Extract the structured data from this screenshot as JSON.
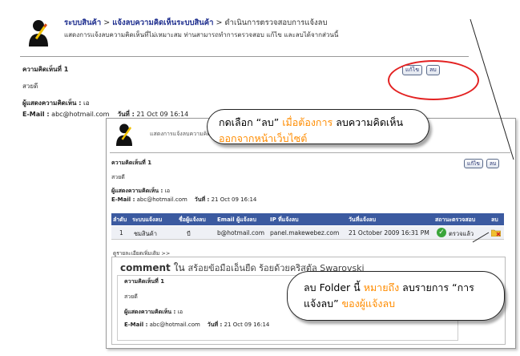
{
  "top": {
    "breadcrumb": {
      "item1": "ระบบสินค้า",
      "sep1": " > ",
      "item2": "แจ้งลบความคิดเห็นระบบสินค้า",
      "sep2": " > ",
      "item3": "ดำเนินการตรวจสอบการแจ้งลบ"
    },
    "subtitle": "แสดงการแจ้งลบความคิดเห็นที่ไม่เหมาะสม ท่านสามารถทำการตรวจสอบ แก้ไข และลบได้จากส่วนนี้",
    "comment_title": "ความคิดเห็นที่ 1",
    "comment_text": "สวยดี",
    "author_label": "ผู้แสดงความคิดเห็น :",
    "author_value": " เอ",
    "email_label": "E-Mail :",
    "email_value": " abc@hotmail.com",
    "date_label": "วันที่ :",
    "date_value": " 21 Oct 09 16:14",
    "edit_button": "แก้ไข",
    "delete_button": "ลบ"
  },
  "callout1": {
    "part1": "กดเลือก “ลบ” ",
    "part2": "เมื่อต้องการ",
    "part3": " ลบความคิดเห็น ",
    "part4": "ออกจากหน้าเว็บไซต์"
  },
  "second": {
    "subtitle": "แสดงการแจ้งลบความคิดเ",
    "comment_title": "ความคิดเห็นที่ 1",
    "comment_text": "สวยดี",
    "author_label": "ผู้แสดงความคิดเห็น :",
    "author_value": " เอ",
    "email_label": "E-Mail :",
    "email_value": " abc@hotmail.com",
    "date_label": "วันที่ :",
    "date_value": " 21 Oct 09 16:14",
    "edit_button": "แก้ไข",
    "delete_button": "ลบ",
    "table": {
      "headers": [
        "ลำดับ",
        "ระบบแจ้งลบ",
        "ชื่อผู้แจ้งลบ",
        "Email ผู้แจ้งลบ",
        "IP ที่แจ้งลบ",
        "วันที่แจ้งลบ",
        "สถานะตรวจสอบ",
        "ลบ"
      ],
      "row": {
        "no": "1",
        "system": "ชมสินค้า",
        "name": "บี",
        "email": "b@hotmail.com",
        "ip": "panel.makewebez.com",
        "date": "21 October 2009 16:31 PM",
        "status": "ตรวจแล้ว"
      }
    },
    "details_link": "ดูรายละเอียดเพิ่มเติม >>",
    "detail": {
      "comment_word": "comment",
      "in_word": " ใน ",
      "product": "สร้อยข้อมือเอ็นยืด ร้อยด้วยคริสตัล Swarovski",
      "comment_title": "ความคิดเห็นที่ 1",
      "comment_text": "สวยดี",
      "author_label": "ผู้แสดงความคิดเห็น :",
      "author_value": " เอ",
      "email_label": "E-Mail :",
      "email_value": " abc@hotmail.com",
      "date_label": "วันที่ :",
      "date_value": " 21 Oct 09 16:14"
    }
  },
  "callout2": {
    "part1": "ลบ Folder นี้ ",
    "part2": "หมายถึง",
    "part3": " ลบรายการ “การแจ้งลบ” ",
    "part4": "ของผู้แจ้งลบ"
  },
  "colors": {
    "accent_orange": "#ff8c00",
    "highlight_red": "#e32222",
    "link_blue": "#1f2f8f",
    "table_header_blue": "#3b5aa0",
    "status_green": "#3aa53a"
  }
}
